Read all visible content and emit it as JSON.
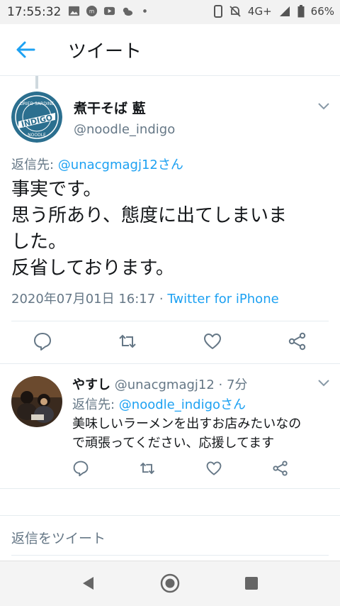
{
  "status_bar": {
    "time": "17:55:32",
    "network": "4G+",
    "battery": "66%",
    "left_icons": [
      "image-icon",
      "app-icon",
      "youtube-icon",
      "weather-icon",
      "dot-icon"
    ],
    "right_icons": [
      "phone-icon",
      "mute-icon",
      "signal-icon",
      "battery-icon"
    ]
  },
  "app_bar": {
    "title": "ツイート",
    "back_icon": "arrow-left-icon"
  },
  "main_tweet": {
    "author_name": "煮干そば 藍",
    "author_handle": "@noodle_indigo",
    "avatar_logo": {
      "top": "DRIED SARDINE",
      "middle": "INDIGO",
      "bottom": "NOODLE"
    },
    "reply_prefix": "返信先: ",
    "reply_to": "@unacgmagj12さん",
    "text_lines": [
      "事実です。",
      "思う所あり、態度に出てしまいま",
      "した。",
      "反省しております。"
    ],
    "timestamp": "2020年07月01日 16:17 · ",
    "source": "Twitter for iPhone"
  },
  "reply_tweet": {
    "author_name": "やすし",
    "author_handle": "@unacgmagj12 · 7分",
    "reply_prefix": "返信先: ",
    "reply_to": "@noodle_indigoさん",
    "text_lines": [
      "美味しいラーメンを出すお店みたいなの",
      "で頑張ってください、応援してます"
    ]
  },
  "compose": {
    "placeholder": "返信をツイート"
  },
  "colors": {
    "accent": "#1da1f2",
    "secondary_text": "#657786",
    "logo_blue": "#2b6f8f"
  }
}
